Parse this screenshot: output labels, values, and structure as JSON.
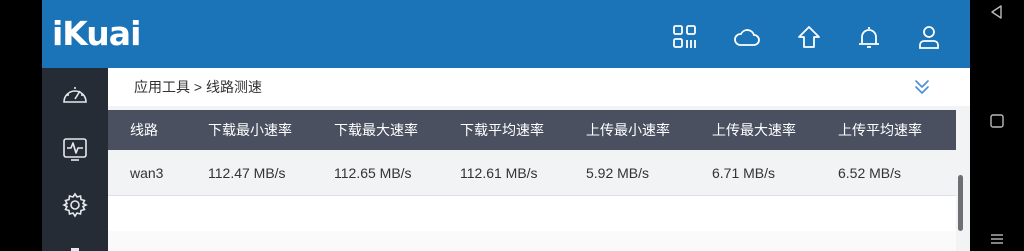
{
  "app": {
    "logo": "iKuai"
  },
  "header": {
    "icons": [
      "qr-code-icon",
      "cloud-icon",
      "home-icon",
      "bell-icon",
      "user-icon"
    ]
  },
  "sidebar": {
    "items": [
      {
        "icon": "speedometer-icon"
      },
      {
        "icon": "monitor-chart-icon"
      },
      {
        "icon": "gear-icon"
      }
    ]
  },
  "breadcrumb": {
    "text": "应用工具 > 线路测速"
  },
  "table": {
    "columns": [
      "线路",
      "下载最小速率",
      "下载最大速率",
      "下载平均速率",
      "上传最小速率",
      "上传最大速率",
      "上传平均速率"
    ],
    "rows": [
      [
        "wan3",
        "112.47 MB/s",
        "112.65 MB/s",
        "112.61 MB/s",
        "5.92 MB/s",
        "6.71 MB/s",
        "6.52 MB/s"
      ]
    ]
  },
  "colors": {
    "header": "#1b73b8",
    "sidebar": "#252c36",
    "table_header": "#4a5060",
    "collapse_accent": "#4a8fd8"
  }
}
